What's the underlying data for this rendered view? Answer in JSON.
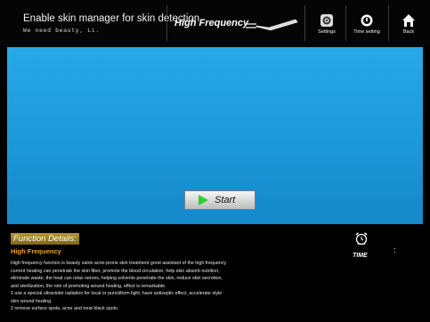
{
  "header": {
    "title": "Enable skin manager for skin detection",
    "subtitle": "We need beauty, Li.",
    "mode_label": "High Frequency",
    "buttons": {
      "settings": "Settings",
      "time_setting": "Time setting",
      "back": "Back"
    }
  },
  "main": {
    "start_label": "Start"
  },
  "details": {
    "heading": "Function Details:",
    "function_name": "High Frequency",
    "lines": [
      "High frequency function is beauty salon acne-prone skin treatment good assistant of the high frequency",
      "current heating can penetrate the skin fiber, promote the blood circulation, help skin absorb nutrition,",
      "eliminate waste, the heat can relax nerves, helping solvents penetrate the skin, reduce skin secretion,",
      "and sterilization, the role of promoting wound healing, effect is remarkable.",
      "1 use a special ultraviolet radiation for local or punctiform light, have antiseptic effect, accelerate style",
      "skin wound healing.",
      "2 remove surface spots, acne and treat black spots."
    ]
  },
  "timer": {
    "label": "TIME",
    "value": ":"
  },
  "colors": {
    "panel_blue": "#1c98d8",
    "heading_gold": "#9a7e22",
    "function_orange": "#f0a020",
    "play_green": "#2fd12f"
  },
  "icons": {
    "wand": "wand-icon",
    "settings": "gear-icon",
    "time_setting": "timer-icon",
    "back": "home-icon",
    "start": "play-icon",
    "alarm": "alarm-clock-icon"
  }
}
